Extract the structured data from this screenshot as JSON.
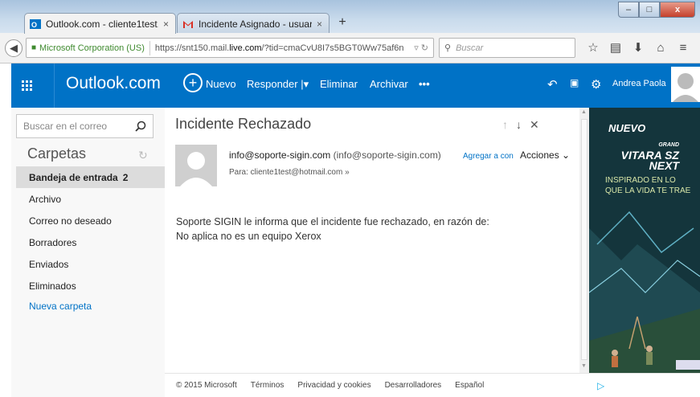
{
  "browser": {
    "tabs": [
      {
        "label": "Outlook.com - cliente1test...",
        "close": "×",
        "active": true
      },
      {
        "label": "Incidente Asignado - usuar...",
        "close": "×",
        "active": false
      }
    ],
    "new_tab": "+",
    "window_buttons": {
      "min": "–",
      "max": "□",
      "close": "x"
    },
    "identity": "Microsoft Corporation (US)",
    "url_prefix": "https://snt150.mail.",
    "url_domain": "live.com",
    "url_rest": "/?tid=cmaCvU8I7s5BGT0Ww75af6n",
    "search_placeholder": "Buscar"
  },
  "header": {
    "brand": "Outlook.com",
    "new_label": "Nuevo",
    "reply_label": "Responder",
    "delete_label": "Eliminar",
    "archive_label": "Archivar",
    "more_label": "•••",
    "user_name": "Andrea Paola"
  },
  "sidebar": {
    "search_placeholder": "Buscar en el correo",
    "folders_heading": "Carpetas",
    "items": [
      {
        "label": "Bandeja de entrada",
        "count": "2"
      },
      {
        "label": "Archivo"
      },
      {
        "label": "Correo no deseado"
      },
      {
        "label": "Borradores"
      },
      {
        "label": "Enviados"
      },
      {
        "label": "Eliminados"
      }
    ],
    "new_folder": "Nueva carpeta"
  },
  "message": {
    "subject": "Incidente Rechazado",
    "from_email": "info@soporte-sigin.com",
    "from_paren": "(info@soporte-sigin.com)",
    "add_contact": "Agregar a con",
    "actions": "Acciones",
    "to": "Para: cliente1test@hotmail.com",
    "body_line1": "Soporte SIGIN le informa que el incidente fue rechazado, en razón de:",
    "body_line2": "No aplica no es un equipo Xerox"
  },
  "ad": {
    "headline": "NUEVO",
    "brand_line1": "GRAND",
    "brand_line2": "VITARA SZ",
    "brand_line3": "NEXT",
    "tagline1": "INSPIRADO EN LO",
    "tagline2": "QUE LA VIDA TE TRAE"
  },
  "footer": {
    "copyright": "© 2015 Microsoft",
    "terms": "Términos",
    "privacy": "Privacidad y cookies",
    "developers": "Desarrolladores",
    "language": "Español"
  },
  "colors": {
    "outlook_blue": "#0072c6",
    "selected_folder": "#dcdcdc",
    "identity_green": "#3f8a2f"
  }
}
